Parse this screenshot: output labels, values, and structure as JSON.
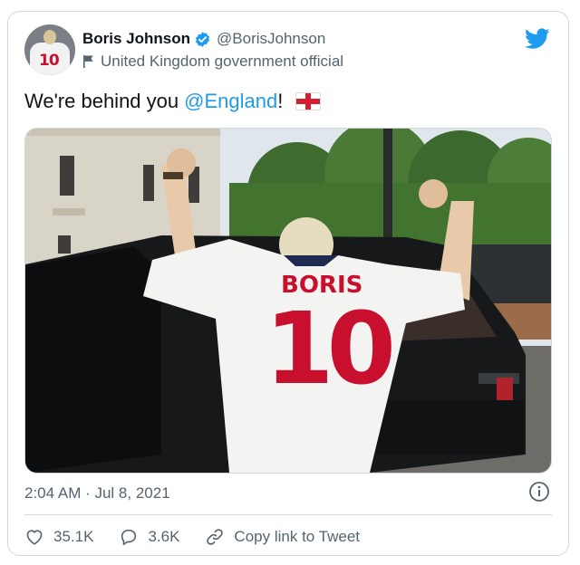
{
  "user": {
    "display_name": "Boris Johnson",
    "handle": "@BorisJohnson",
    "label": "United Kingdom government official",
    "avatar_icon": "avatar-england-shirt-10",
    "avatar_number": "10"
  },
  "tweet": {
    "text_prefix": "We're behind you",
    "mention": "@England",
    "text_suffix": "!",
    "emoji": "england-flag-icon",
    "timestamp": "2:04 AM · Jul 8, 2021"
  },
  "photo": {
    "jersey_name": "BORIS",
    "jersey_number": "10"
  },
  "actions": {
    "likes": "35.1K",
    "replies": "3.6K",
    "copy_link_label": "Copy link to Tweet"
  },
  "colors": {
    "accent": "#1d9bf0",
    "secondary_text": "#536471",
    "border": "#cfd9de",
    "jersey_red": "#c8102e"
  }
}
